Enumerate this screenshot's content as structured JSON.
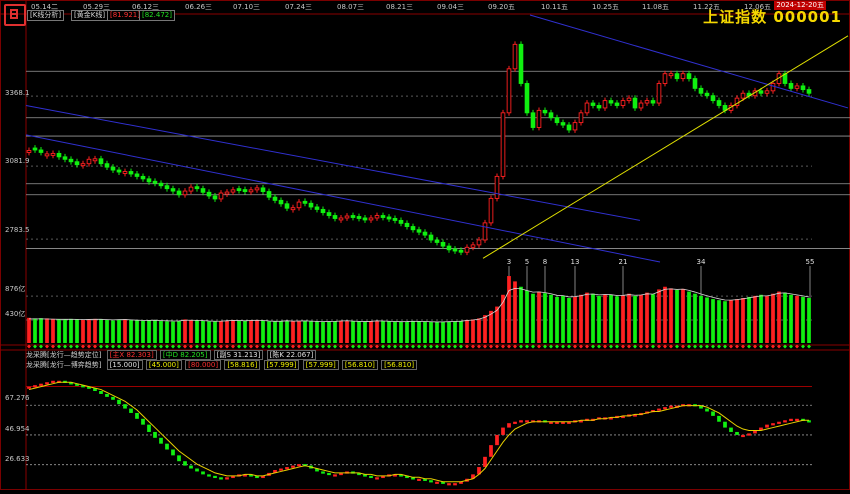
{
  "app": {
    "title": "上证指数 000001",
    "date_badge": "2024-12-20五",
    "buttons": {
      "kline_analysis": "[K线分析]",
      "golden_kline": "[黄金K线]"
    },
    "top_values": [
      "[81.921]",
      "[82.472]"
    ]
  },
  "colors": {
    "up": "#ff2020",
    "down": "#10f010",
    "accent": "#f5d800",
    "channel": "#3030d0",
    "support": "#e0e000"
  },
  "icons": {
    "logo": "app-logo-icon"
  },
  "chart_data": [
    {
      "type": "candlestick",
      "panel": "price",
      "x_date_labels": [
        "05.14二",
        "05.29三",
        "06.12三",
        "06.26三",
        "07.10三",
        "07.24三",
        "08.07三",
        "08.21三",
        "09.04三",
        "09.20五",
        "10.11五",
        "10.25五",
        "11.08五",
        "11.22五",
        "12.06五"
      ],
      "y_ticks": [
        3368.1,
        3081.9,
        2783.5
      ],
      "ylim": [
        2690,
        3700
      ],
      "channel_lines": "blue descending channel + yellow rising support line",
      "close": [
        3146,
        3148,
        3138,
        3132,
        3134,
        3120,
        3110,
        3100,
        3088,
        3092,
        3110,
        3112,
        3092,
        3078,
        3066,
        3058,
        3060,
        3050,
        3040,
        3030,
        3018,
        3012,
        3002,
        2990,
        2980,
        2965,
        2980,
        2996,
        2990,
        2975,
        2960,
        2948,
        2972,
        2976,
        2985,
        2982,
        2978,
        2985,
        2993,
        2978,
        2955,
        2942,
        2928,
        2910,
        2912,
        2935,
        2930,
        2915,
        2905,
        2892,
        2880,
        2868,
        2870,
        2878,
        2872,
        2868,
        2862,
        2870,
        2880,
        2872,
        2866,
        2860,
        2848,
        2835,
        2822,
        2812,
        2800,
        2780,
        2770,
        2755,
        2740,
        2735,
        2730,
        2750,
        2760,
        2780,
        2850,
        2950,
        3040,
        3300,
        3480,
        3580,
        3420,
        3300,
        3240,
        3310,
        3300,
        3280,
        3260,
        3250,
        3230,
        3260,
        3300,
        3340,
        3330,
        3320,
        3350,
        3340,
        3330,
        3350,
        3360,
        3320,
        3340,
        3350,
        3340,
        3420,
        3460,
        3460,
        3440,
        3460,
        3440,
        3400,
        3380,
        3370,
        3350,
        3330,
        3310,
        3330,
        3360,
        3380,
        3370,
        3390,
        3380,
        3390,
        3420,
        3460,
        3420,
        3400,
        3410,
        3395,
        3380
      ],
      "color": [
        "up",
        "down",
        "down",
        "up",
        "up",
        "down",
        "down",
        "down",
        "down",
        "up",
        "up",
        "up",
        "down",
        "down",
        "down",
        "down",
        "up",
        "down",
        "down",
        "down",
        "down",
        "down",
        "down",
        "down",
        "down",
        "down",
        "up",
        "up",
        "down",
        "down",
        "down",
        "down",
        "up",
        "up",
        "up",
        "down",
        "down",
        "up",
        "up",
        "down",
        "down",
        "down",
        "down",
        "down",
        "up",
        "up",
        "down",
        "down",
        "down",
        "down",
        "down",
        "down",
        "up",
        "up",
        "down",
        "down",
        "down",
        "up",
        "up",
        "down",
        "down",
        "down",
        "down",
        "down",
        "down",
        "down",
        "down",
        "down",
        "down",
        "down",
        "down",
        "down",
        "down",
        "up",
        "up",
        "up",
        "up",
        "up",
        "up",
        "up",
        "up",
        "up",
        "down",
        "down",
        "down",
        "up",
        "down",
        "down",
        "down",
        "down",
        "down",
        "up",
        "up",
        "up",
        "down",
        "down",
        "up",
        "down",
        "down",
        "up",
        "up",
        "down",
        "up",
        "up",
        "down",
        "up",
        "up",
        "up",
        "down",
        "up",
        "down",
        "down",
        "down",
        "down",
        "down",
        "down",
        "down",
        "up",
        "up",
        "up",
        "down",
        "up",
        "down",
        "up",
        "up",
        "up",
        "down",
        "down",
        "up",
        "down",
        "down"
      ]
    },
    {
      "type": "bar",
      "panel": "volume",
      "y_ticks": [
        "876亿",
        "430亿"
      ],
      "ylim": [
        0,
        1400
      ],
      "markers": [
        "3",
        "5",
        "8",
        "13",
        "21",
        "34",
        "55"
      ],
      "color_source": "price.color",
      "values": [
        470,
        460,
        465,
        460,
        450,
        445,
        440,
        450,
        440,
        430,
        440,
        450,
        445,
        430,
        420,
        440,
        445,
        430,
        420,
        415,
        420,
        430,
        410,
        405,
        400,
        410,
        440,
        430,
        420,
        415,
        405,
        400,
        410,
        420,
        430,
        420,
        410,
        425,
        430,
        420,
        405,
        400,
        410,
        420,
        405,
        410,
        415,
        405,
        400,
        395,
        400,
        405,
        415,
        420,
        405,
        400,
        395,
        410,
        420,
        410,
        405,
        400,
        395,
        400,
        410,
        405,
        400,
        395,
        390,
        395,
        400,
        405,
        410,
        430,
        440,
        460,
        520,
        600,
        680,
        900,
        1250,
        1150,
        1050,
        980,
        920,
        960,
        930,
        900,
        860,
        880,
        840,
        870,
        900,
        940,
        920,
        880,
        910,
        900,
        870,
        890,
        920,
        880,
        900,
        940,
        910,
        1000,
        1050,
        1020,
        990,
        1010,
        960,
        920,
        880,
        850,
        820,
        800,
        780,
        800,
        820,
        840,
        860,
        880,
        900,
        880,
        920,
        960,
        940,
        900,
        880,
        860,
        840
      ],
      "ma": [
        450,
        450,
        450,
        448,
        445,
        444,
        442,
        444,
        441,
        438,
        440,
        443,
        442,
        436,
        431,
        436,
        438,
        432,
        426,
        422,
        423,
        426,
        418,
        414,
        410,
        412,
        425,
        425,
        422,
        418,
        410,
        406,
        408,
        414,
        422,
        420,
        414,
        420,
        425,
        420,
        410,
        405,
        407,
        414,
        409,
        410,
        413,
        408,
        403,
        399,
        400,
        403,
        410,
        415,
        408,
        403,
        400,
        405,
        413,
        410,
        406,
        402,
        398,
        400,
        406,
        404,
        401,
        397,
        393,
        395,
        398,
        402,
        407,
        420,
        430,
        445,
        480,
        540,
        610,
        760,
        980,
        1020,
        1010,
        980,
        950,
        955,
        940,
        920,
        890,
        885,
        860,
        865,
        882,
        910,
        915,
        898,
        905,
        902,
        886,
        888,
        904,
        892,
        896,
        918,
        913,
        956,
        1003,
        1011,
        1000,
        1005,
        982,
        951,
        915,
        882,
        851,
        825,
        802,
        801,
        810,
        825,
        842,
        861,
        880,
        880,
        900,
        930,
        935,
        917,
        898,
        879,
        859
      ]
    },
    {
      "type": "line",
      "panel": "indicator",
      "header_rows": [
        {
          "name": "龙采腾[龙行—趋势定位]",
          "values": [
            "[主X 82.303]",
            "[中D 82.205]",
            "[副S 31.213]",
            "[陈K 22.067]"
          ],
          "colors": [
            "red",
            "green",
            "white",
            "white"
          ]
        },
        {
          "name": "龙采腾[龙行—博弈趋势]",
          "values": [
            "[15.000]",
            "[45.000]",
            "[80.000]",
            "[58.816]",
            "[57.999]",
            "[57.999]",
            "[56.810]",
            "[56.810]"
          ],
          "colors": [
            "white",
            "yellow",
            "red",
            "yellow",
            "yellow",
            "yellow",
            "yellow",
            "yellow"
          ]
        }
      ],
      "y_ticks": [
        67.276,
        46.954,
        26.633
      ],
      "ylim": [
        10,
        90
      ],
      "levels": [
        80,
        67.276,
        46.954,
        26.633
      ],
      "values": [
        80,
        81,
        82,
        83,
        84,
        84,
        83,
        82,
        81,
        80,
        79,
        77,
        75,
        73,
        71,
        68,
        65,
        62,
        58,
        54,
        49,
        45,
        41,
        37,
        33,
        29,
        26,
        24,
        22,
        20,
        19,
        18,
        17,
        18,
        19,
        20,
        20,
        19,
        18,
        19,
        21,
        23,
        24,
        25,
        26,
        27,
        26,
        24,
        22,
        21,
        20,
        20,
        21,
        22,
        21,
        20,
        19,
        18,
        18,
        19,
        20,
        20,
        19,
        18,
        17,
        17,
        16,
        15,
        15,
        14,
        14,
        14,
        15,
        17,
        20,
        25,
        32,
        40,
        47,
        52,
        55,
        56,
        57,
        57,
        57,
        57,
        56,
        56,
        56,
        56,
        56,
        57,
        57,
        58,
        58,
        59,
        59,
        59,
        60,
        60,
        61,
        61,
        62,
        63,
        64,
        65,
        66,
        67,
        67,
        68,
        68,
        67,
        65,
        63,
        60,
        56,
        52,
        49,
        47,
        47,
        48,
        50,
        52,
        54,
        55,
        56,
        57,
        58,
        58,
        57,
        56
      ],
      "signal": [
        78,
        79,
        80,
        81,
        82,
        83,
        83,
        83,
        82,
        81,
        80,
        79,
        78,
        76,
        74,
        72,
        70,
        67,
        64,
        60,
        56,
        52,
        48,
        44,
        40,
        36,
        33,
        30,
        27,
        25,
        23,
        21,
        20,
        19,
        19,
        19,
        20,
        20,
        19,
        19,
        20,
        21,
        22,
        23,
        24,
        25,
        26,
        25,
        24,
        23,
        22,
        21,
        21,
        21,
        21,
        21,
        20,
        20,
        19,
        19,
        19,
        20,
        20,
        19,
        18,
        18,
        17,
        17,
        16,
        15,
        15,
        15,
        15,
        16,
        17,
        20,
        24,
        30,
        36,
        42,
        47,
        51,
        53,
        55,
        56,
        56,
        56,
        56,
        56,
        56,
        56,
        56,
        57,
        57,
        57,
        58,
        58,
        59,
        59,
        60,
        60,
        61,
        61,
        62,
        63,
        63,
        64,
        65,
        66,
        67,
        67,
        67,
        67,
        66,
        64,
        62,
        59,
        56,
        53,
        51,
        50,
        50,
        50,
        51,
        52,
        53,
        54,
        55,
        56,
        57,
        57
      ]
    }
  ]
}
